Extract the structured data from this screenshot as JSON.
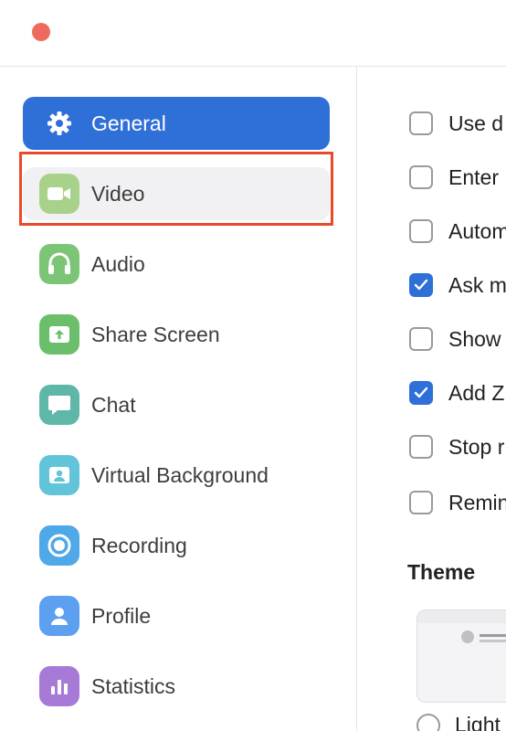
{
  "window": {
    "close_button_color": "#ee6a5f"
  },
  "sidebar": {
    "items": [
      {
        "label": "General",
        "icon": "gear-icon",
        "color": "#2f6fd8",
        "state": "active"
      },
      {
        "label": "Video",
        "icon": "video-camera-icon",
        "color": "#a8d28a",
        "state": "highlighted"
      },
      {
        "label": "Audio",
        "icon": "headphones-icon",
        "color": "#7cc576"
      },
      {
        "label": "Share Screen",
        "icon": "share-screen-icon",
        "color": "#6cbf6a"
      },
      {
        "label": "Chat",
        "icon": "chat-bubble-icon",
        "color": "#5fb8a7"
      },
      {
        "label": "Virtual Background",
        "icon": "virtual-background-icon",
        "color": "#62c4d8"
      },
      {
        "label": "Recording",
        "icon": "recording-icon",
        "color": "#4fa8e8"
      },
      {
        "label": "Profile",
        "icon": "profile-icon",
        "color": "#5d9ff0"
      },
      {
        "label": "Statistics",
        "icon": "statistics-icon",
        "color": "#a87ad8"
      }
    ]
  },
  "main": {
    "options": [
      {
        "label": "Use d",
        "checked": false
      },
      {
        "label": "Enter",
        "checked": false
      },
      {
        "label": "Autom",
        "checked": false
      },
      {
        "label": "Ask m",
        "checked": true
      },
      {
        "label": "Show",
        "checked": false
      },
      {
        "label": "Add Z",
        "checked": true
      },
      {
        "label": "Stop r",
        "checked": false
      },
      {
        "label": "Remin",
        "checked": false
      }
    ],
    "theme": {
      "title": "Theme",
      "option_label": "Light"
    }
  }
}
